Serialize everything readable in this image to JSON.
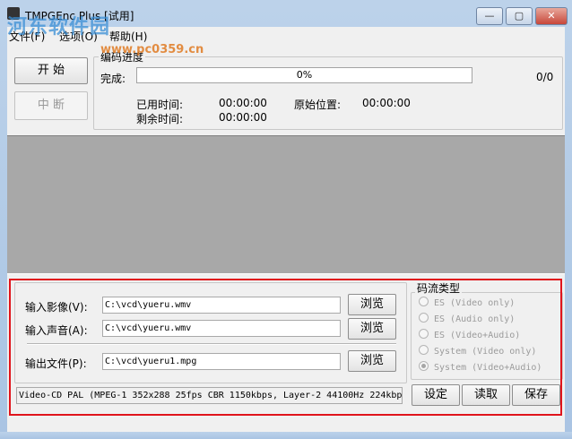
{
  "window": {
    "title": "TMPGEnc Plus [试用]",
    "controls": {
      "minimize": "—",
      "maximize": "▢",
      "close": "✕"
    },
    "watermark": "河东软件园",
    "watermark_url": "www.pc0359.cn"
  },
  "menu": {
    "items": [
      {
        "label": "文件(F)"
      },
      {
        "label": "选项(O)"
      },
      {
        "label": "帮助(H)"
      }
    ]
  },
  "controls": {
    "start_label": "开 始",
    "abort_label": "中 断"
  },
  "progress_group": {
    "title": "编码进度",
    "complete_label": "完成:",
    "percent_text": "0%",
    "percent_value": 0,
    "count": "0/0",
    "elapsed_label": "已用时间:",
    "elapsed_value": "00:00:00",
    "remaining_label": "剩余时间:",
    "remaining_value": "00:00:00",
    "source_pos_label": "原始位置:",
    "source_pos_value": "00:00:00"
  },
  "files": {
    "video_label": "输入影像(V):",
    "video_value": "C:\\vcd\\yueru.wmv",
    "audio_label": "输入声音(A):",
    "audio_value": "C:\\vcd\\yueru.wmv",
    "output_label": "输出文件(P):",
    "output_value": "C:\\vcd\\yueru1.mpg",
    "browse_label": "浏览"
  },
  "stream_type": {
    "title": "码流类型",
    "options": [
      {
        "label": "ES (Video only)",
        "checked": false
      },
      {
        "label": "ES (Audio only)",
        "checked": false
      },
      {
        "label": "ES (Video+Audio)",
        "checked": false
      },
      {
        "label": "System (Video only)",
        "checked": false
      },
      {
        "label": "System (Video+Audio)",
        "checked": true
      }
    ]
  },
  "status": {
    "summary": "Video-CD PAL (MPEG-1 352x288 25fps CBR 1150kbps, Layer-2 44100Hz 224kbps"
  },
  "footer_buttons": {
    "settings": "设定",
    "load": "读取",
    "save": "保存"
  },
  "colors": {
    "highlight": "#e0141c",
    "preview_bg": "#a8a8a8",
    "progress_fill": "#3cb34a"
  }
}
